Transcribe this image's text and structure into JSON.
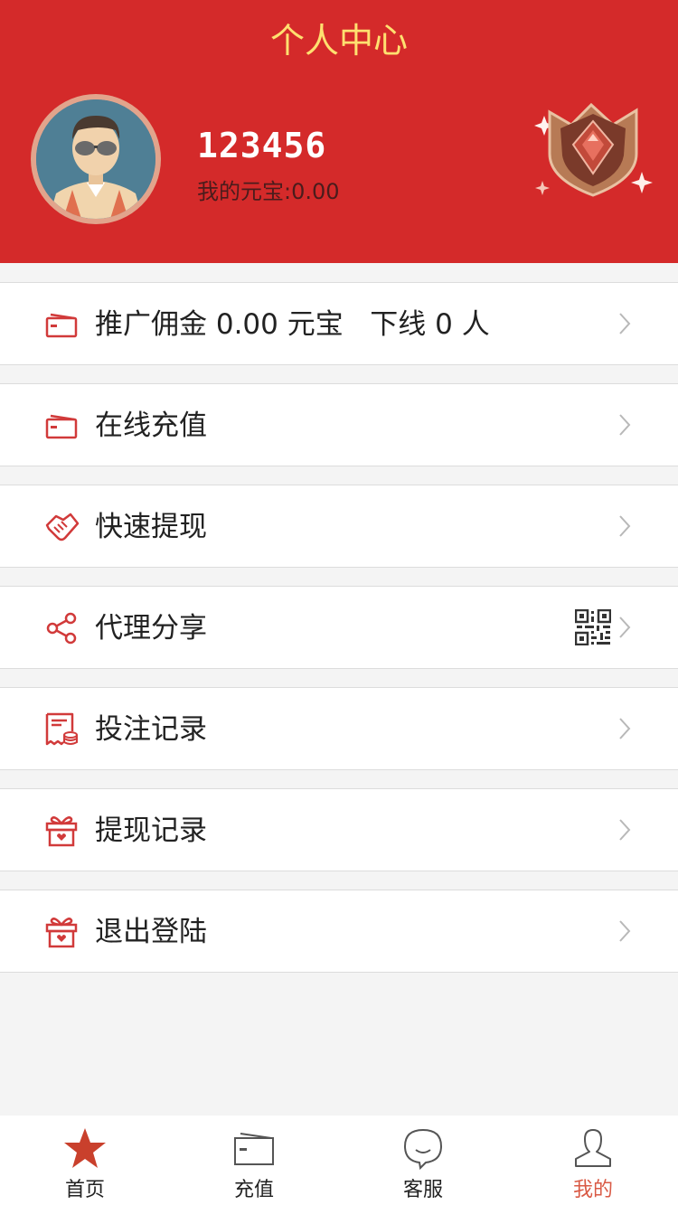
{
  "header": {
    "title": "个人中心",
    "username": "123456",
    "balance": "我的元宝:0.00",
    "avatar_icon": "user-avatar",
    "badge_icon": "rank-badge-icon"
  },
  "menu": {
    "promotion": {
      "label": "推广佣金 0.00 元宝   下线 0 人",
      "icon": "wallet-icon"
    },
    "recharge": {
      "label": "在线充值",
      "icon": "wallet-icon"
    },
    "withdraw": {
      "label": "快速提现",
      "icon": "handshake-icon"
    },
    "share": {
      "label": "代理分享",
      "icon": "share-icon",
      "extra_icon": "qr-code-icon"
    },
    "bet_records": {
      "label": "投注记录",
      "icon": "receipt-icon"
    },
    "withdraw_records": {
      "label": "提现记录",
      "icon": "gift-icon"
    },
    "logout": {
      "label": "退出登陆",
      "icon": "gift-icon"
    }
  },
  "tabbar": {
    "home": {
      "label": "首页",
      "icon": "star-icon"
    },
    "recharge": {
      "label": "充值",
      "icon": "wallet-icon"
    },
    "service": {
      "label": "客服",
      "icon": "chat-bubble-icon"
    },
    "mine": {
      "label": "我的",
      "icon": "person-icon",
      "active": true
    }
  },
  "colors": {
    "header_bg": "#d42a2a",
    "title": "#ffe070",
    "icon_red": "#d13a3a",
    "active_tab": "#d95a45",
    "page_bg": "#f4f4f4"
  }
}
